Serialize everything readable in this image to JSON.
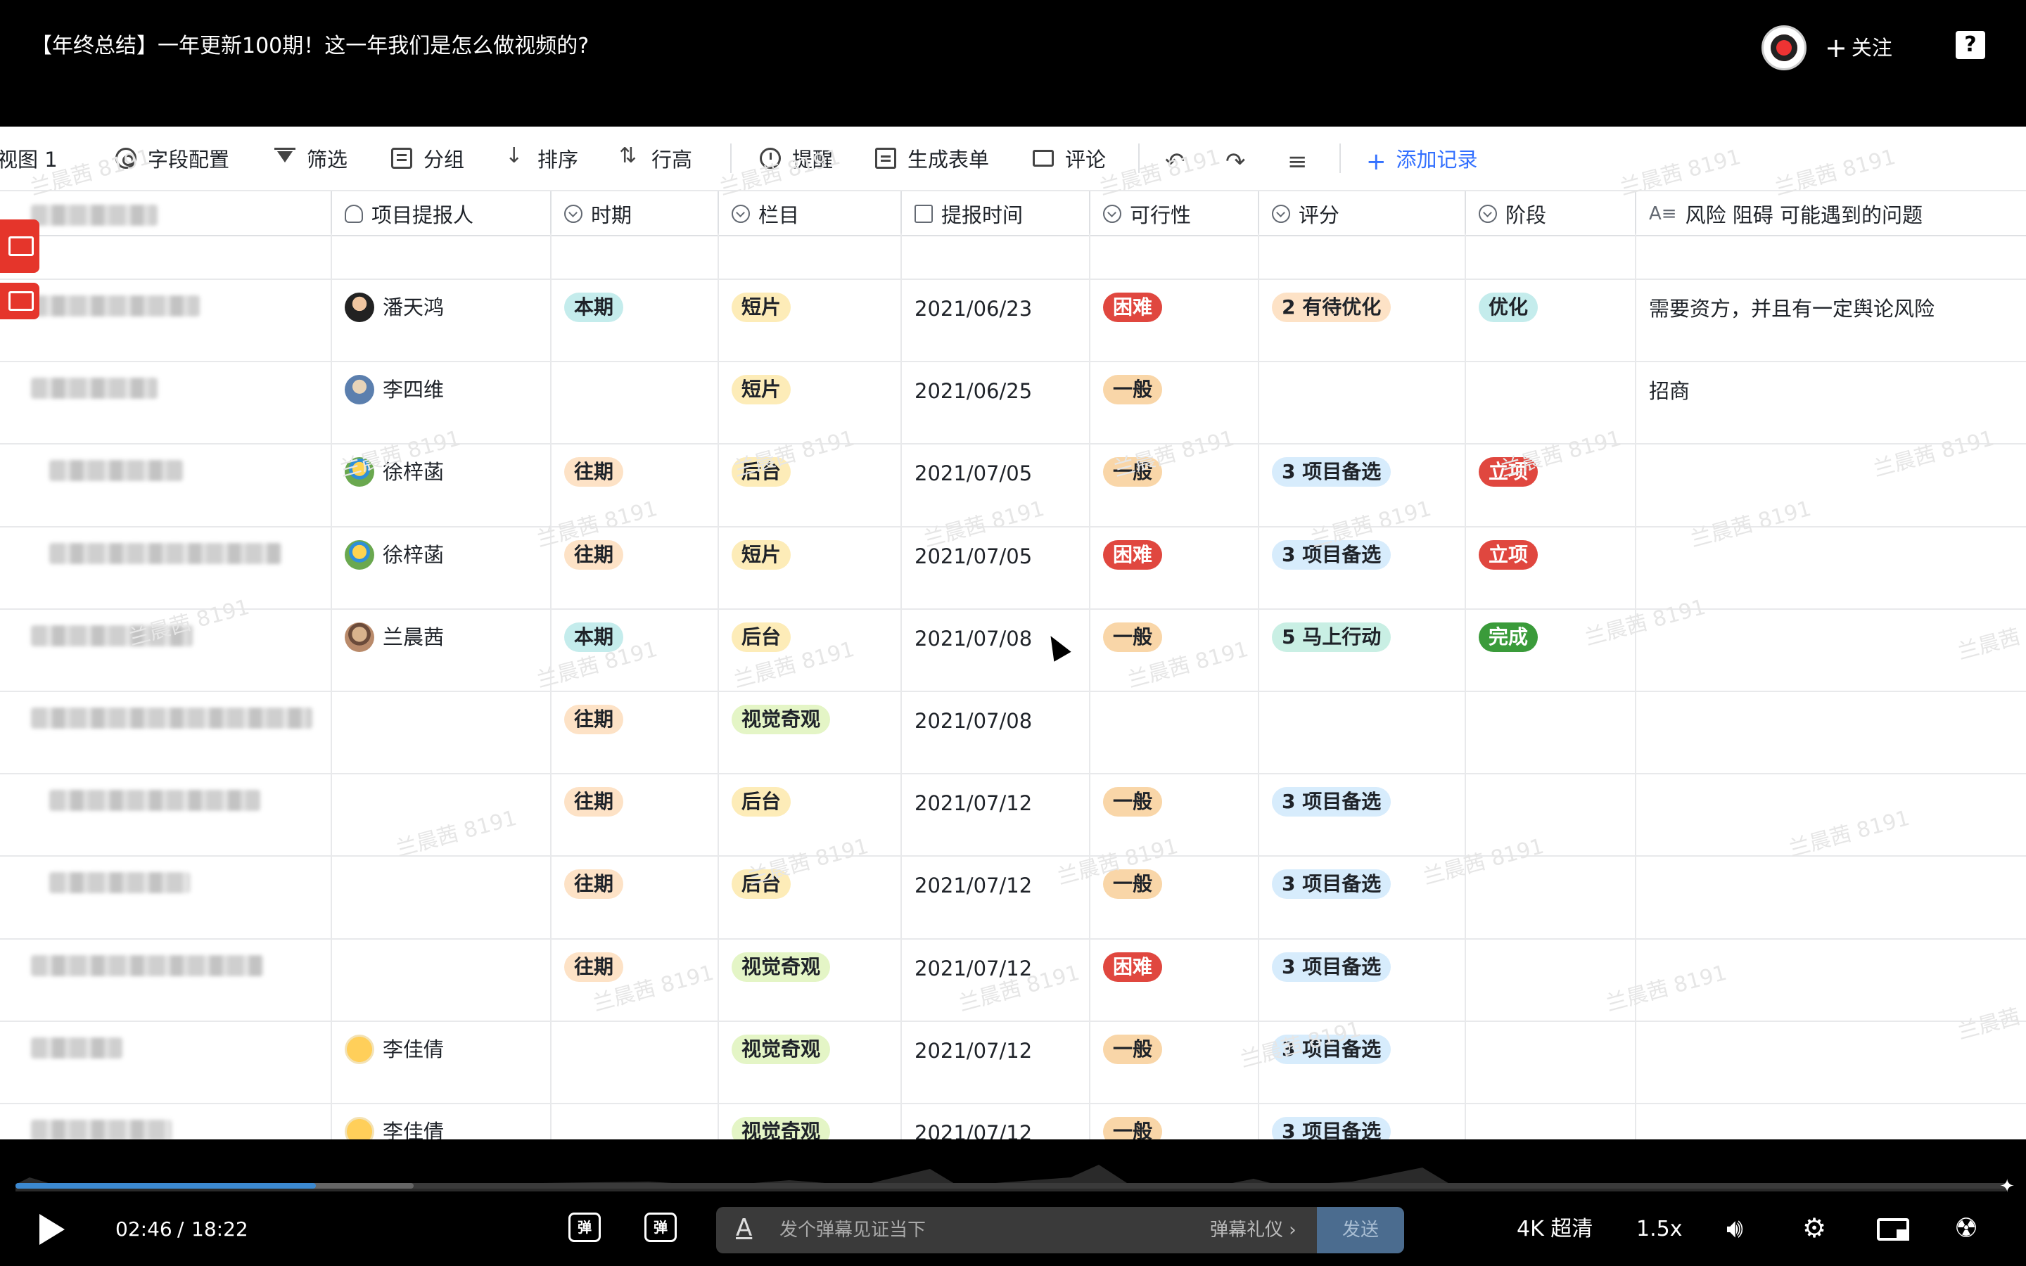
{
  "header": {
    "title": "【年终总结】一年更新100期！这一年我们是怎么做视频的?",
    "follow_label": "关注",
    "help_icon": "help-icon"
  },
  "toolbar": {
    "view_label": "视图 1",
    "field_config": "字段配置",
    "filter": "筛选",
    "group": "分组",
    "sort": "排序",
    "row_height": "行高",
    "remind": "提醒",
    "gen_form": "生成表单",
    "comment": "评论",
    "add_record": "添加记录"
  },
  "columns": {
    "proposer": "项目提报人",
    "period": "时期",
    "column": "栏目",
    "report_time": "提报时间",
    "feasibility": "可行性",
    "score": "评分",
    "stage": "阶段",
    "risk": "风险 阻碍 可能遇到的问题"
  },
  "watermark": "兰晨茜 8191",
  "rows": [
    {
      "proposer": "潘天鸿",
      "period": "本期",
      "column": "短片",
      "date": "2021/06/23",
      "feasibility": "困难",
      "score": "2 有待优化",
      "stage": "优化",
      "risk": "需要资方，并且有一定舆论风险"
    },
    {
      "proposer": "李四维",
      "period": "",
      "column": "短片",
      "date": "2021/06/25",
      "feasibility": "一般",
      "score": "",
      "stage": "",
      "risk": "招商"
    },
    {
      "proposer": "徐梓菡",
      "period": "往期",
      "column": "后台",
      "date": "2021/07/05",
      "feasibility": "一般",
      "score": "3 项目备选",
      "stage": "立项",
      "risk": ""
    },
    {
      "proposer": "徐梓菡",
      "period": "往期",
      "column": "短片",
      "date": "2021/07/05",
      "feasibility": "困难",
      "score": "3 项目备选",
      "stage": "立项",
      "risk": ""
    },
    {
      "proposer": "兰晨茜",
      "period": "本期",
      "column": "后台",
      "date": "2021/07/08",
      "feasibility": "一般",
      "score": "5 马上行动",
      "stage": "完成",
      "risk": ""
    },
    {
      "proposer": "",
      "period": "往期",
      "column": "视觉奇观",
      "date": "2021/07/08",
      "feasibility": "",
      "score": "",
      "stage": "",
      "risk": ""
    },
    {
      "proposer": "",
      "period": "往期",
      "column": "后台",
      "date": "2021/07/12",
      "feasibility": "一般",
      "score": "3 项目备选",
      "stage": "",
      "risk": ""
    },
    {
      "proposer": "",
      "period": "往期",
      "column": "后台",
      "date": "2021/07/12",
      "feasibility": "一般",
      "score": "3 项目备选",
      "stage": "",
      "risk": ""
    },
    {
      "proposer": "",
      "period": "往期",
      "column": "视觉奇观",
      "date": "2021/07/12",
      "feasibility": "困难",
      "score": "3 项目备选",
      "stage": "",
      "risk": ""
    },
    {
      "proposer": "李佳倩",
      "period": "",
      "column": "视觉奇观",
      "date": "2021/07/12",
      "feasibility": "一般",
      "score": "3 项目备选",
      "stage": "",
      "risk": ""
    },
    {
      "proposer": "李佳倩",
      "period": "",
      "column": "视觉奇观",
      "date": "2021/07/12",
      "feasibility": "一般",
      "score": "3 项目备选",
      "stage": "",
      "risk": ""
    }
  ],
  "tag_colors": {
    "本期": {
      "bg": "#c4ecec",
      "fg": "#1f2329"
    },
    "往期": {
      "bg": "#fde2c6",
      "fg": "#1f2329"
    },
    "短片": {
      "bg": "#fdecb8",
      "fg": "#1f2329"
    },
    "后台": {
      "bg": "#fdecb8",
      "fg": "#1f2329"
    },
    "视觉奇观": {
      "bg": "#e4f5c6",
      "fg": "#1f2329"
    },
    "困难": {
      "bg": "#e0473f",
      "fg": "#ffffff"
    },
    "一般": {
      "bg": "#f9d6a8",
      "fg": "#1f2329"
    },
    "2 有待优化": {
      "bg": "#fde2c6",
      "fg": "#1f2329"
    },
    "3 项目备选": {
      "bg": "#d7ecfc",
      "fg": "#1f2329"
    },
    "5 马上行动": {
      "bg": "#c9efe4",
      "fg": "#1f2329"
    },
    "优化": {
      "bg": "#c4ecec",
      "fg": "#1f2329"
    },
    "立项": {
      "bg": "#e0473f",
      "fg": "#ffffff"
    },
    "完成": {
      "bg": "#3a9b3a",
      "fg": "#ffffff"
    }
  },
  "player": {
    "current_time": "02:46",
    "separator": "/",
    "total_time": "18:22",
    "progress_played": 0.151,
    "progress_buffered": 0.2,
    "danmaku_placeholder": "发个弹幕见证当下",
    "danmaku_gift": "弹幕礼仪",
    "send_label": "发送",
    "quality": "4K 超清",
    "speed": "1.5x",
    "played_color": "#3c89d0"
  }
}
